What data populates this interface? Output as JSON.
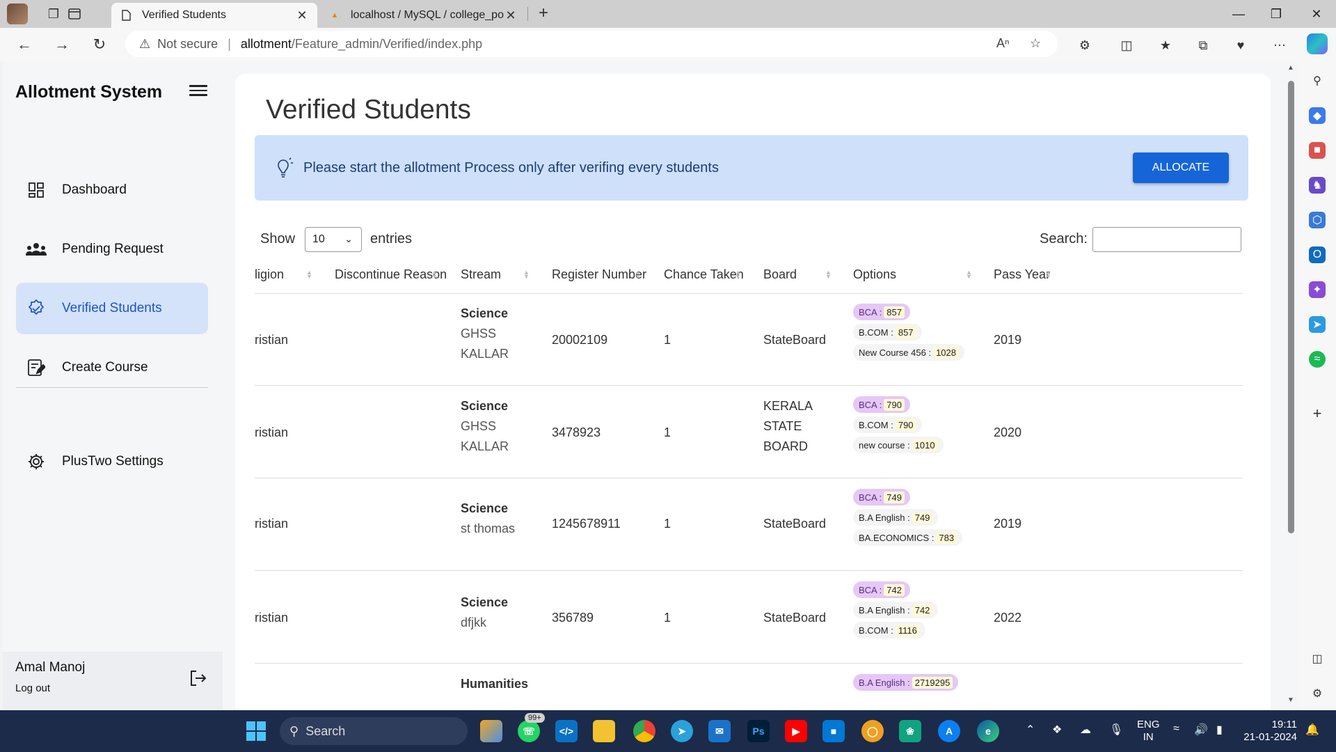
{
  "browser": {
    "tabs": [
      {
        "title": "Verified Students"
      },
      {
        "title": "localhost / MySQL / college_port"
      }
    ],
    "address": {
      "security_label": "Not secure",
      "host": "allotment",
      "path": "/Feature_admin/Verified/index.php"
    }
  },
  "sidebar": {
    "brand": "Allotment System",
    "items": [
      {
        "label": "Dashboard"
      },
      {
        "label": "Pending Request"
      },
      {
        "label": "Verified Students"
      },
      {
        "label": "Create Course"
      },
      {
        "label": "PlusTwo Settings"
      }
    ],
    "user": {
      "name": "Amal Manoj",
      "logout": "Log out"
    }
  },
  "main": {
    "title": "Verified Students",
    "alert": {
      "text": "Please start the allotment Process only after verifing every students",
      "button": "ALLOCATE"
    },
    "table_controls": {
      "show": "Show",
      "length": "10",
      "entries": "entries",
      "search_label": "Search:"
    },
    "columns": [
      "ligion",
      "Discontinue Reason",
      "Stream",
      "Register Number",
      "Chance Taken",
      "Board",
      "Options",
      "Pass Year"
    ],
    "rows": [
      {
        "religion": "ristian",
        "reason": "",
        "stream": "Science",
        "school": [
          "GHSS",
          "KALLAR"
        ],
        "register": "20002109",
        "chance": "1",
        "board": [
          "StateBoard"
        ],
        "options": [
          {
            "course": "BCA :",
            "mark": "857"
          },
          {
            "course": "B.COM :",
            "mark": "857"
          },
          {
            "course": "New Course 456 :",
            "mark": "1028"
          }
        ],
        "pass_year": "2019"
      },
      {
        "religion": "ristian",
        "reason": "",
        "stream": "Science",
        "school": [
          "GHSS",
          "KALLAR"
        ],
        "register": "3478923",
        "chance": "1",
        "board": [
          "KERALA",
          "STATE",
          "BOARD"
        ],
        "options": [
          {
            "course": "BCA :",
            "mark": "790"
          },
          {
            "course": "B.COM :",
            "mark": "790"
          },
          {
            "course": "new course :",
            "mark": "1010"
          }
        ],
        "pass_year": "2020"
      },
      {
        "religion": "ristian",
        "reason": "",
        "stream": "Science",
        "school": [
          "st thomas"
        ],
        "register": "1245678911",
        "chance": "1",
        "board": [
          "StateBoard"
        ],
        "options": [
          {
            "course": "BCA :",
            "mark": "749"
          },
          {
            "course": "B.A English :",
            "mark": "749"
          },
          {
            "course": "BA.ECONOMICS :",
            "mark": "783"
          }
        ],
        "pass_year": "2019"
      },
      {
        "religion": "ristian",
        "reason": "",
        "stream": "Science",
        "school": [
          "dfjkk"
        ],
        "register": "356789",
        "chance": "1",
        "board": [
          "StateBoard"
        ],
        "options": [
          {
            "course": "BCA :",
            "mark": "742"
          },
          {
            "course": "B.A English :",
            "mark": "742"
          },
          {
            "course": "B.COM :",
            "mark": "1116"
          }
        ],
        "pass_year": "2022"
      },
      {
        "stream": "Humanities",
        "options": [
          {
            "course": "B.A English :",
            "mark": "2719295"
          }
        ]
      }
    ]
  },
  "taskbar": {
    "search": "Search",
    "badge": "99+",
    "lang": [
      "ENG",
      "IN"
    ],
    "time": "19:11",
    "date": "21-01-2024"
  },
  "colors": {
    "accent": "#1565d8",
    "sidebar_active_bg": "#d5e3fa",
    "alert_bg": "#cfe0fb",
    "option_first_bg": "#e5c8f5",
    "taskbar": "#1c2b4a"
  }
}
